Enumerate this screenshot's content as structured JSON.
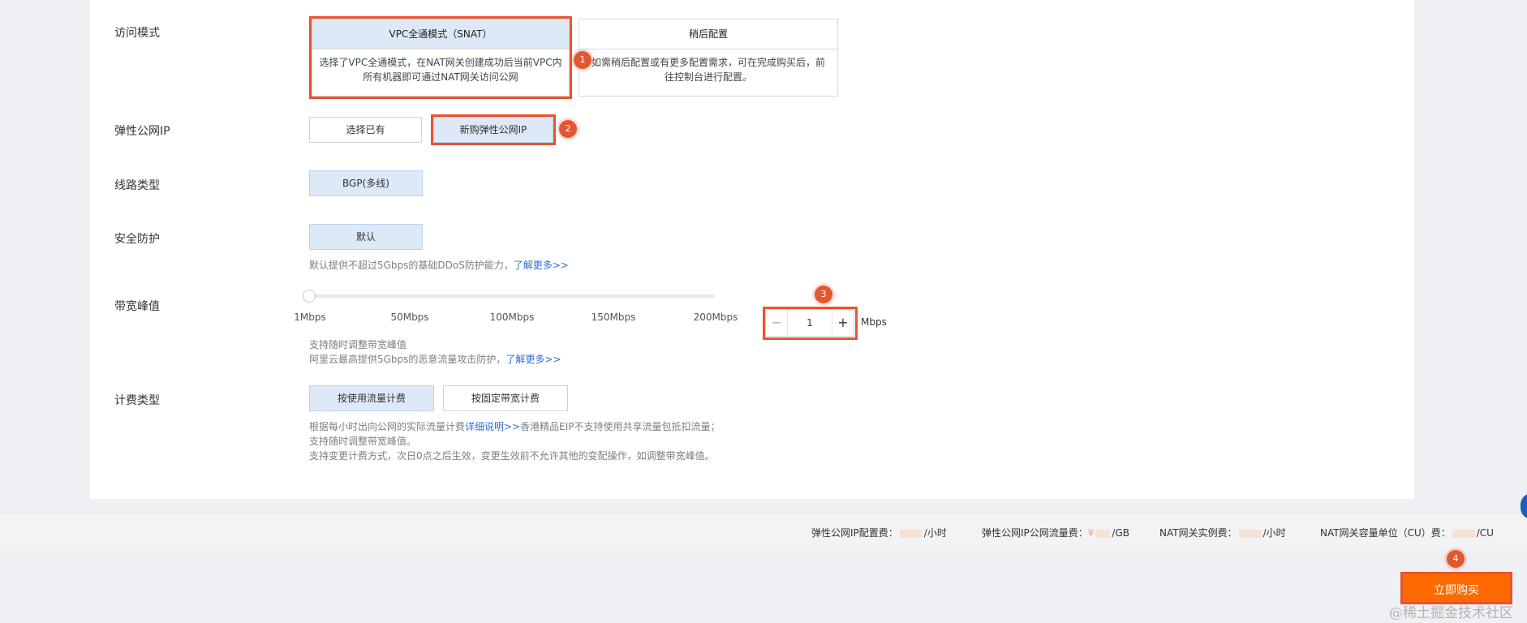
{
  "rows": {
    "access_mode": "访问模式",
    "eip": "弹性公网IP",
    "line": "线路类型",
    "security": "安全防护",
    "bandwidth": "带宽峰值",
    "billing": "计费类型"
  },
  "access_cards": [
    {
      "title": "VPC全通模式（SNAT）",
      "desc1": "选择了VPC全通模式，在NAT网关创建成功后当前VPC内",
      "desc2": "所有机器即可通过NAT网关访问公网"
    },
    {
      "title": "稍后配置",
      "desc1": "如需稍后配置或有更多配置需求，可在完成购买后，前",
      "desc2": "往控制台进行配置。"
    }
  ],
  "eip_options": [
    "选择已有",
    "新购弹性公网IP"
  ],
  "line_option": "BGP(多线)",
  "security_option": "默认",
  "security_hint": "默认提供不超过5Gbps的基础DDoS防护能力，",
  "learn_more": "了解更多>>",
  "slider_ticks": [
    "1Mbps",
    "50Mbps",
    "100Mbps",
    "150Mbps",
    "200Mbps"
  ],
  "bandwidth_value": "1",
  "bandwidth_unit": "Mbps",
  "stepper_minus": "−",
  "stepper_plus": "+",
  "bandwidth_hint1": "支持随时调整带宽峰值",
  "bandwidth_hint2": "阿里云最高提供5Gbps的恶意流量攻击防护，",
  "billing_options": [
    "按使用流量计费",
    "按固定带宽计费"
  ],
  "billing_hint1_a": "根据每小时出向公网的实际流量计费",
  "billing_hint1_link": "详细说明>>",
  "billing_hint1_b": "香港精品EIP不支持使用共享流量包抵扣流量；",
  "billing_hint2": "支持随时调整带宽峰值。",
  "billing_hint3": "支持变更计费方式，次日0点之后生效，变更生效前不允许其他的变配操作，如调整带宽峰值。",
  "fees": [
    {
      "label": "弹性公网IP配置费：",
      "prefix": "",
      "unit": "/小时"
    },
    {
      "label": "弹性公网IP公网流量费：",
      "prefix": "¥",
      "unit": "/GB"
    },
    {
      "label": "NAT网关实例费：",
      "prefix": "",
      "unit": "/小时"
    },
    {
      "label": "NAT网关容量单位（CU）费：",
      "prefix": "",
      "unit": "/CU"
    }
  ],
  "buy_button": "立即购买",
  "badges": [
    "1",
    "2",
    "3",
    "4"
  ],
  "watermark": "@稀土掘金技术社区",
  "colors": {
    "highlight": "#e8542e",
    "buy": "#ff6a00",
    "link": "#2e6fd0",
    "selected": "#dde9f6"
  }
}
